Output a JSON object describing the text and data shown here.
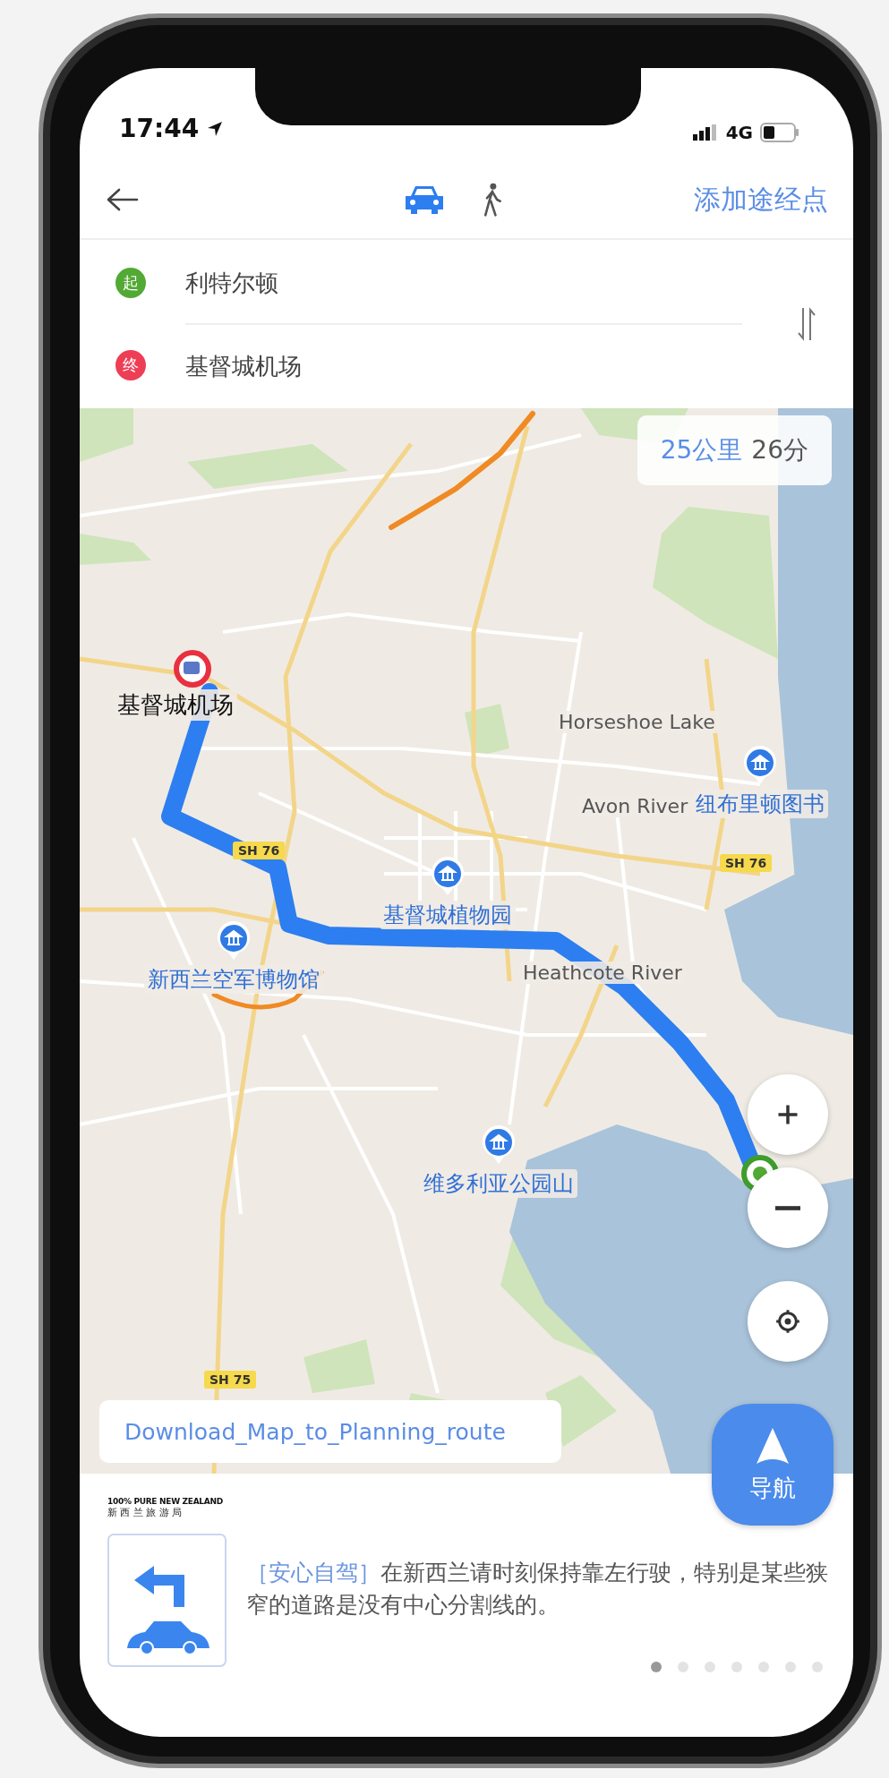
{
  "status_bar": {
    "time": "17:44",
    "network": "4G"
  },
  "nav": {
    "modes": [
      {
        "kind": "car",
        "selected": true
      },
      {
        "kind": "walk",
        "selected": false
      }
    ],
    "add_waypoint": "添加途经点"
  },
  "route": {
    "stops": [
      {
        "badge": "起",
        "name": "利特尔顿",
        "color": "#52a934"
      },
      {
        "badge": "终",
        "name": "基督城机场",
        "color": "#ee3e55"
      }
    ]
  },
  "map": {
    "summary": {
      "distance": "25公里",
      "duration": "26分"
    },
    "labels": [
      {
        "kind": "destination",
        "text": "基督城机场"
      },
      {
        "kind": "place",
        "text": "Horseshoe Lake"
      },
      {
        "kind": "poi",
        "text": "纽布里顿图书"
      },
      {
        "kind": "place",
        "text": "Avon River"
      },
      {
        "kind": "road",
        "text": "SH 76"
      },
      {
        "kind": "road",
        "text": "SH 76"
      },
      {
        "kind": "poi",
        "text": "基督城植物园"
      },
      {
        "kind": "poi",
        "text": "新西兰空军博物馆"
      },
      {
        "kind": "place",
        "text": "Heathcote River"
      },
      {
        "kind": "poi",
        "text": "维多利亚公园山"
      },
      {
        "kind": "road",
        "text": "SH 75"
      }
    ],
    "download_banner": "Download_Map_to_Planning_route"
  },
  "navigate_button": "导航",
  "tip": {
    "brand": "100% PURE NEW ZEALAND",
    "brand_sub": "新 西 兰 旅 游 局",
    "tag": "［安心自驾］",
    "text": "在新西兰请时刻保持靠左行驶，特别是某些狭窄的道路是没有中心分割线的。"
  },
  "pager": [
    {
      "selected": true
    },
    {
      "selected": false
    },
    {
      "selected": false
    },
    {
      "selected": false
    },
    {
      "selected": false
    },
    {
      "selected": false
    },
    {
      "selected": false
    }
  ]
}
